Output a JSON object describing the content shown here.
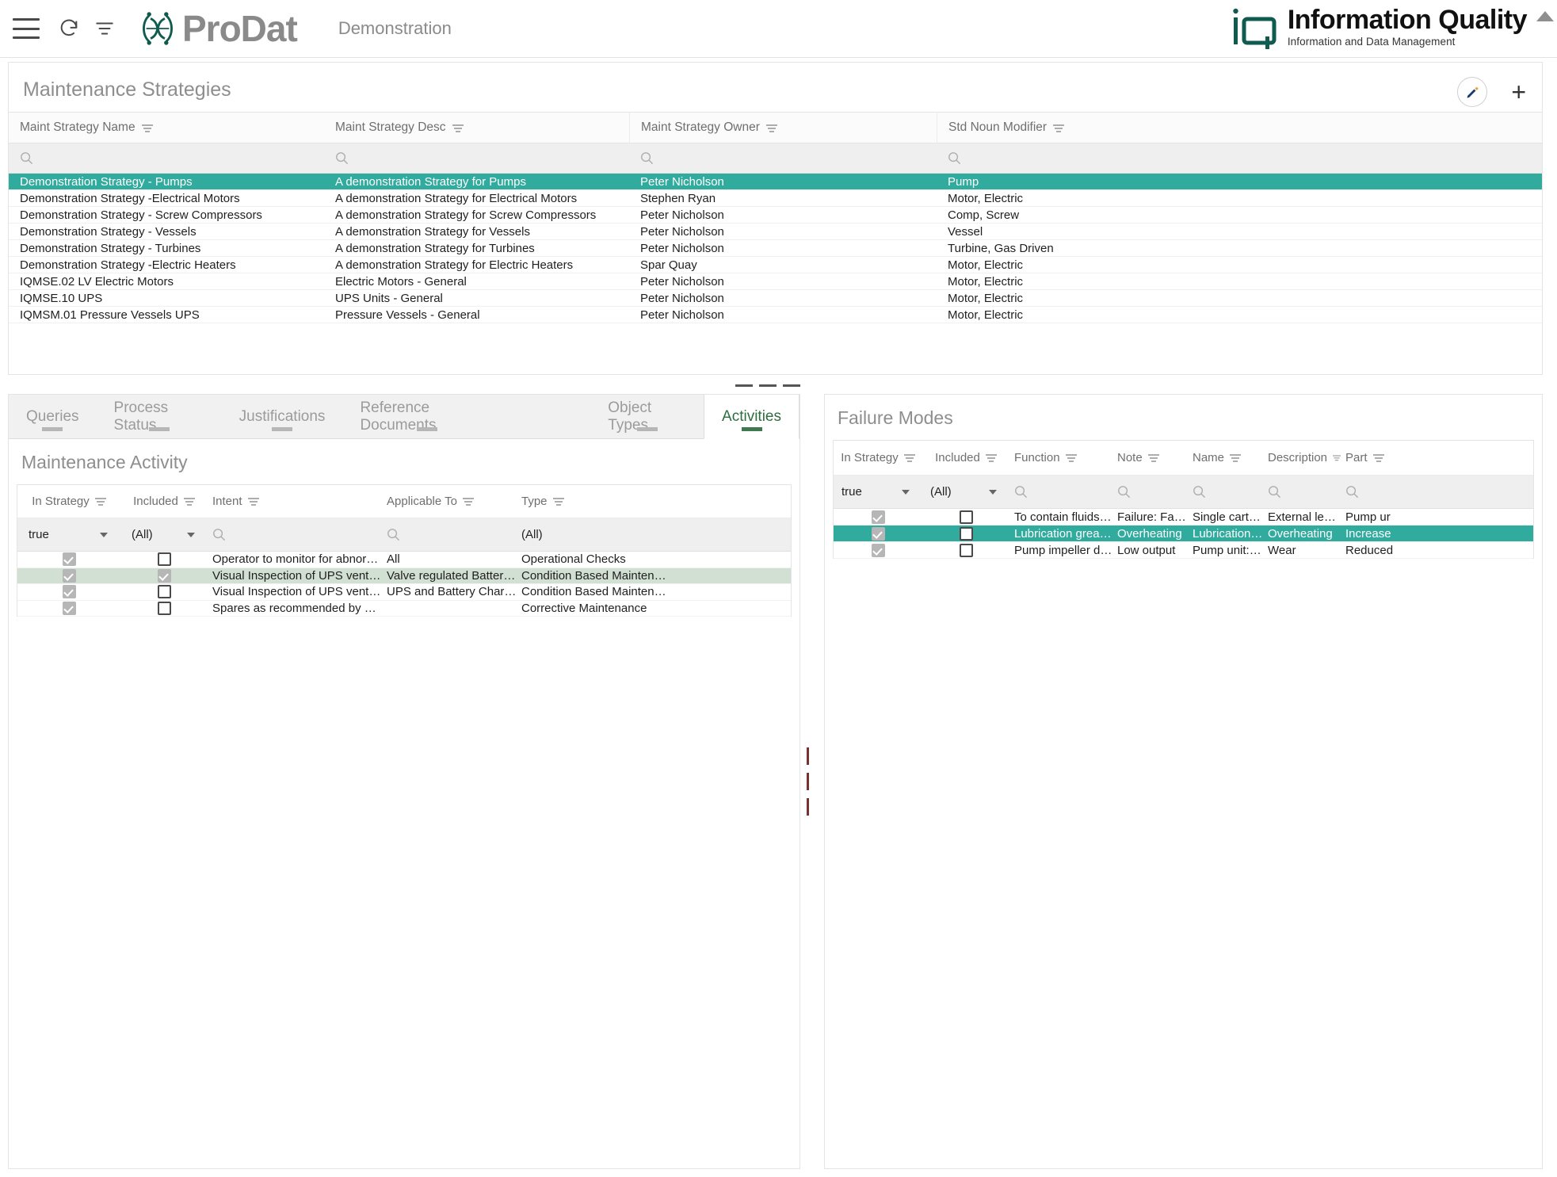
{
  "app": {
    "brand_name": "ProDat",
    "environment_label": "Demonstration",
    "corp_title": "Information Quality",
    "corp_subtitle": "Information and Data Management",
    "accent_teal": "#30ab9e",
    "accent_green": "#d2e0d4",
    "active_tab_color": "#2d6e3f"
  },
  "toolbar": {
    "menu_icon": "hamburger-menu-icon",
    "refresh_icon": "refresh-icon",
    "filter_icon": "filter-icon",
    "scroll_up_icon": "scroll-up-arrow-icon"
  },
  "strategies": {
    "title": "Maintenance Strategies",
    "edit_icon": "pencil-edit-icon",
    "add_icon": "plus-add-icon",
    "columns": [
      "Maint Strategy Name",
      "Maint Strategy Desc",
      "Maint Strategy Owner",
      "Std Noun Modifier"
    ],
    "filter_placeholders": [
      "",
      "",
      "",
      ""
    ],
    "rows": [
      {
        "name": "Demonstration Strategy - Pumps",
        "desc": "A demonstration Strategy for Pumps",
        "owner": "Peter Nicholson",
        "noun": "Pump",
        "selected": true
      },
      {
        "name": "Demonstration Strategy -Electrical Motors",
        "desc": "A demonstration Strategy for Electrical Motors",
        "owner": "Stephen Ryan",
        "noun": "Motor, Electric",
        "selected": false
      },
      {
        "name": "Demonstration Strategy - Screw Compressors",
        "desc": "A demonstration Strategy for Screw Compressors",
        "owner": "Peter Nicholson",
        "noun": "Comp, Screw",
        "selected": false
      },
      {
        "name": "Demonstration Strategy - Vessels",
        "desc": "A demonstration Strategy for Vessels",
        "owner": "Peter Nicholson",
        "noun": "Vessel",
        "selected": false
      },
      {
        "name": "Demonstration Strategy - Turbines",
        "desc": "A demonstration Strategy for Turbines",
        "owner": "Peter Nicholson",
        "noun": "Turbine, Gas Driven",
        "selected": false
      },
      {
        "name": "Demonstration Strategy -Electric Heaters",
        "desc": "A demonstration Strategy for Electric Heaters",
        "owner": "Spar Quay",
        "noun": "Motor, Electric",
        "selected": false
      },
      {
        "name": "IQMSE.02 LV Electric Motors",
        "desc": "Electric Motors - General",
        "owner": "Peter Nicholson",
        "noun": "Motor, Electric",
        "selected": false
      },
      {
        "name": "IQMSE.10 UPS",
        "desc": "UPS Units - General",
        "owner": "Peter Nicholson",
        "noun": "Motor, Electric",
        "selected": false
      },
      {
        "name": "IQMSM.01 Pressure Vessels UPS",
        "desc": "Pressure Vessels - General",
        "owner": "Peter Nicholson",
        "noun": "Motor, Electric",
        "selected": false
      }
    ]
  },
  "tabs": [
    {
      "label": "Queries",
      "active": false
    },
    {
      "label": "Process Status",
      "active": false
    },
    {
      "label": "Justifications",
      "active": false
    },
    {
      "label": "Reference Documents",
      "active": false
    },
    {
      "label": "Object Types",
      "active": false
    },
    {
      "label": "Activities",
      "active": true
    }
  ],
  "maintenance_activity": {
    "title": "Maintenance Activity",
    "columns": [
      "In Strategy",
      "Included",
      "Intent",
      "Applicable To",
      "Type"
    ],
    "filters": {
      "in_strategy": "true",
      "included": "(All)",
      "intent": "",
      "applicable_to": "",
      "type": "(All)"
    },
    "rows": [
      {
        "in_strategy": true,
        "included": false,
        "intent": "Operator to monitor for abnormal …",
        "applicable_to": "All",
        "type": "Operational Checks",
        "highlighted": false
      },
      {
        "in_strategy": true,
        "included": true,
        "intent": "Visual Inspection of UPS ventilation",
        "applicable_to": "Valve regulated Battery U…",
        "type": "Condition Based Maintenanc",
        "highlighted": true
      },
      {
        "in_strategy": true,
        "included": false,
        "intent": "Visual Inspection of UPS ventilation",
        "applicable_to": "UPS and Battery Charger",
        "type": "Condition Based Maintenanc",
        "highlighted": false
      },
      {
        "in_strategy": true,
        "included": false,
        "intent": "Spares as recommended by OEM …",
        "applicable_to": "",
        "type": "Corrective Maintenance",
        "highlighted": false
      }
    ]
  },
  "failure_modes": {
    "title": "Failure Modes",
    "columns": [
      "In Strategy",
      "Included",
      "Function",
      "Note",
      "Name",
      "Description",
      "Part"
    ],
    "filters": {
      "in_strategy": "true",
      "included": "(All)",
      "function": "",
      "note": "",
      "name": "",
      "description": "",
      "part": ""
    },
    "rows": [
      {
        "in_strategy": true,
        "included": false,
        "function": "To contain fluids d…",
        "note": "Failure: Fail…",
        "name": "Single cartri…",
        "description": "External lea…",
        "part": "Pump ur",
        "selected": false
      },
      {
        "in_strategy": true,
        "included": false,
        "function": "Lubrication grease …",
        "note": "Overheating",
        "name": "Lubrication …",
        "description": "Overheating",
        "part": "Increase",
        "selected": true
      },
      {
        "in_strategy": true,
        "included": false,
        "function": "Pump impeller da…",
        "note": "Low output",
        "name": "Pump unit: I…",
        "description": "Wear",
        "part": "Reduced",
        "selected": false
      }
    ]
  }
}
